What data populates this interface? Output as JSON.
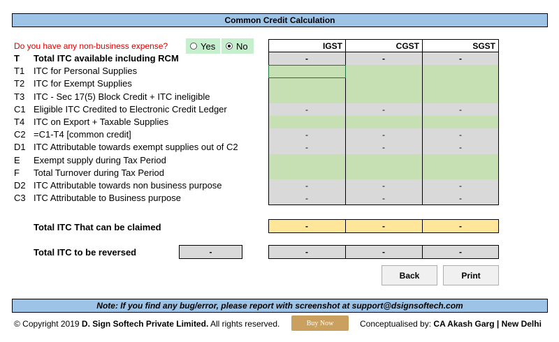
{
  "title": "Common Credit Calculation",
  "question": {
    "text": "Do you have any non-business expense?",
    "options": [
      {
        "label": "Yes",
        "selected": false
      },
      {
        "label": "No",
        "selected": true
      }
    ]
  },
  "columns": [
    "IGST",
    "CGST",
    "SGST"
  ],
  "rows": [
    {
      "code": "T",
      "label": "Total ITC available including RCM",
      "bold": true,
      "values": [
        "-",
        "-",
        "-"
      ],
      "fill": "grey"
    },
    {
      "code": "T1",
      "label": "ITC for Personal Supplies",
      "bold": false,
      "values": [
        "",
        "",
        ""
      ],
      "fill": "green"
    },
    {
      "code": "T2",
      "label": "ITC for Exempt Supplies",
      "bold": false,
      "values": [
        "",
        "",
        ""
      ],
      "fill": "green"
    },
    {
      "code": "T3",
      "label": "ITC - Sec 17(5) Block Credit + ITC ineligible",
      "bold": false,
      "values": [
        "",
        "",
        ""
      ],
      "fill": "green"
    },
    {
      "code": "C1",
      "label": "Eligible ITC Credited to Electronic Credit Ledger",
      "bold": false,
      "values": [
        "-",
        "-",
        "-"
      ],
      "fill": "grey"
    },
    {
      "code": "T4",
      "label": "ITC on Export + Taxable Supplies",
      "bold": false,
      "values": [
        "",
        "",
        ""
      ],
      "fill": "green"
    },
    {
      "code": "C2",
      "label": "=C1-T4 [common credit]",
      "bold": false,
      "values": [
        "-",
        "-",
        "-"
      ],
      "fill": "grey"
    },
    {
      "code": "D1",
      "label": "ITC Attributable towards exempt supplies out of C2",
      "bold": false,
      "values": [
        "-",
        "-",
        "-"
      ],
      "fill": "grey"
    },
    {
      "code": "E",
      "label": "Exempt supply during Tax Period",
      "bold": false,
      "values": [
        "",
        "",
        ""
      ],
      "fill": "green"
    },
    {
      "code": "F",
      "label": "Total Turnover during Tax Period",
      "bold": false,
      "values": [
        "",
        "",
        ""
      ],
      "fill": "green"
    },
    {
      "code": "D2",
      "label": "ITC Attributable towards non business purpose",
      "bold": false,
      "values": [
        "-",
        "-",
        "-"
      ],
      "fill": "grey"
    },
    {
      "code": "C3",
      "label": "ITC Attributable to Business purpose",
      "bold": false,
      "values": [
        "-",
        "-",
        "-"
      ],
      "fill": "grey"
    }
  ],
  "total_claimed": {
    "label": "Total ITC That can be claimed",
    "values": [
      "-",
      "-",
      "-"
    ]
  },
  "total_reversed": {
    "label": "Total ITC to be reversed",
    "total": "-",
    "values": [
      "-",
      "-",
      "-"
    ]
  },
  "buttons": {
    "back": "Back",
    "print": "Print"
  },
  "note": "Note: If you find any bug/error, please report with screenshot at support@dsignsoftech.com",
  "footer": {
    "copyright_prefix": "© Copyright 2019 ",
    "company": "D. Sign Softech Private Limited.",
    "rights": " All rights reserved.",
    "buy_now": "Buy Now",
    "concept_prefix": "Conceptualised by: ",
    "author": "CA Akash Garg",
    "separator": " | ",
    "city": "New Delhi"
  },
  "colors": {
    "banner": "#9dc3e6",
    "grey": "#d9d9d9",
    "green": "#c6e0b4",
    "total": "#ffe699",
    "radio": "#c6efce",
    "question": "#e00000"
  }
}
